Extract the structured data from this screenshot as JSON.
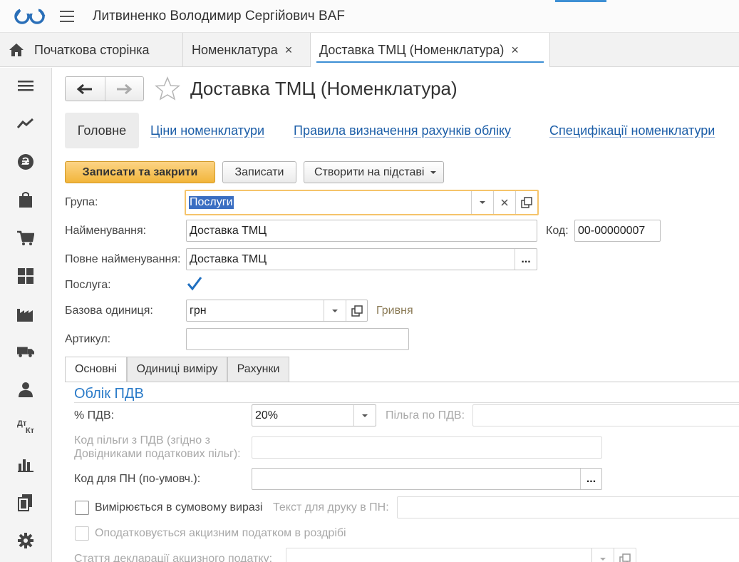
{
  "window": {
    "app_title": "Литвиненко Володимир Сергійович BAF"
  },
  "tabs": [
    {
      "label": "Початкова сторінка"
    },
    {
      "label": "Номенклатура",
      "close": "×"
    },
    {
      "label": "Доставка ТМЦ (Номенклатура)",
      "close": "×"
    }
  ],
  "sidebar": {
    "items": [
      "menu-icon",
      "trend-icon",
      "hryvnia-icon",
      "bag-icon",
      "cart-icon",
      "warehouse-icon",
      "factory-icon",
      "truck-icon",
      "person-icon",
      "dt-kt-icon",
      "bar-chart-icon",
      "documents-icon",
      "gear-icon"
    ],
    "dt_label": "Дт",
    "kt_label": "Кт"
  },
  "form": {
    "title": "Доставка ТМЦ (Номенклатура)",
    "section_tabs": [
      {
        "label": "Головне"
      },
      {
        "label": "Ціни номенклатури"
      },
      {
        "label": "Правила визначення рахунків обліку"
      },
      {
        "label": "Специфікації номенклатури"
      }
    ],
    "buttons": {
      "save_close": "Записати та закрити",
      "save": "Записати",
      "create_based": "Створити на підставі"
    },
    "fields": {
      "group_label": "Група:",
      "group_value": "Послуги",
      "name_label": "Найменування:",
      "name_value": "Доставка ТМЦ",
      "code_label": "Код:",
      "code_value": "00-00000007",
      "full_name_label": "Повне найменування:",
      "full_name_value": "Доставка ТМЦ",
      "service_label": "Послуга:",
      "service_checked": true,
      "unit_label": "Базова одиниця:",
      "unit_value": "грн",
      "unit_desc": "Гривня",
      "article_label": "Артикул:",
      "article_value": ""
    },
    "inner_tabs": [
      {
        "label": "Основні"
      },
      {
        "label": "Одиниці виміру"
      },
      {
        "label": "Рахунки"
      }
    ],
    "vat": {
      "group_title": "Облік ПДВ",
      "vat_label": "% ПДВ:",
      "vat_value": "20%",
      "benefit_label": "Пільга по ПДВ:",
      "benefit_code_label_1": "Код пільги з ПДВ (згідно з",
      "benefit_code_label_2": "Довідниками податкових пільг):",
      "pn_code_label": "Код для ПН (по-умовч.):",
      "sum_measure_label": "Вимірюється в сумовому виразі",
      "print_text_label": "Текст для друку в ПН:",
      "excise_label": "Оподатковується акцизним податком в роздрібі",
      "excise_article_label": "Стаття декларації акцизного податку:"
    },
    "select_button": "..."
  },
  "colors": {
    "accent": "#3d8fd4",
    "link": "#1c5ea8",
    "primary_button": "#f2b53a",
    "group_title": "#2c7cc9"
  }
}
